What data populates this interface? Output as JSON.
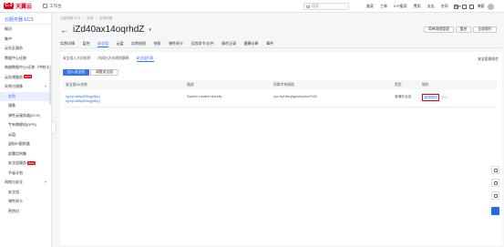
{
  "topbar": {
    "logo_mark": "C-3",
    "logo_text": "天翼云",
    "workspace": "工作台",
    "search_placeholder": "搜索",
    "links": [
      "备案",
      "工单",
      "ICP备案",
      "费用",
      "支出",
      "合同",
      "Ape"
    ],
    "user": "博客"
  },
  "sidebar": {
    "title": "云服务器 ECS",
    "items": [
      {
        "label": "概况",
        "type": "item"
      },
      {
        "label": "集中",
        "type": "item"
      },
      {
        "label": "云社区服务",
        "type": "item"
      },
      {
        "label": "数据中心迁移",
        "type": "item"
      },
      {
        "label": "跨越数据中心/迁移（中航卡）",
        "type": "item"
      },
      {
        "label": "云存储服务",
        "type": "item",
        "tag": "NEW"
      },
      {
        "label": "实例与镜像",
        "type": "group"
      },
      {
        "label": "实例",
        "type": "sub",
        "active": true
      },
      {
        "label": "镜像",
        "type": "sub"
      },
      {
        "label": "弹性云服务器(ECS)",
        "type": "sub"
      },
      {
        "label": "专有物理机(DPS)",
        "type": "sub"
      },
      {
        "label": "云盘",
        "type": "sub"
      },
      {
        "label": "虚拟IP跟踪器",
        "type": "sub"
      },
      {
        "label": "部署实例集",
        "type": "sub"
      },
      {
        "label": "安全组服务",
        "type": "sub",
        "tag": "NEW"
      },
      {
        "label": "节省计划",
        "type": "sub"
      },
      {
        "label": "网络与安全",
        "type": "group"
      },
      {
        "label": "安全组",
        "type": "sub"
      },
      {
        "label": "弹性网卡",
        "type": "sub"
      },
      {
        "label": "密钥对",
        "type": "sub"
      }
    ],
    "collapse_glyph": "‹"
  },
  "main": {
    "breadcrumb": [
      "云服务器 ECS",
      "/",
      "实例",
      "/",
      "实例详情"
    ],
    "back_glyph": "←",
    "title": "iZd40ax14oqrhdZ",
    "title_caret": "▾",
    "actions": [
      "简单网络管理",
      "重启",
      "全部操作"
    ],
    "tabs": [
      "实例详情",
      "监控",
      "安全组",
      "云盘",
      "实例快照",
      "快照",
      "弹性网卡",
      "远程命令/文件",
      "操作记录",
      "健康诊断",
      "事件"
    ],
    "active_tab": 2
  },
  "panel": {
    "subtabs": [
      "安全组入方向规则",
      "内网出方向规则解释",
      "安全组列表"
    ],
    "active_subtab": 2,
    "rule_link": "安全组规则栏",
    "primary_button": "加入安全组",
    "secondary_button": "调整安全组",
    "columns": [
      "安全组ID/名称",
      "描述",
      "所属专有网络",
      "类型",
      "操作"
    ],
    "rows": [
      {
        "id": "sg-bp1abfqd93eqjpf8yrj",
        "name": "sg-bp1abfqd93eqjpf8yrj",
        "description": "System created security...",
        "vpc": "vpc-bp1fbsqfqywdmydoz7h28",
        "type": "普通安全组",
        "op": "管理规则",
        "op_more": "移出"
      }
    ]
  },
  "float_tools": [
    "phone-icon",
    "chat-icon",
    "feedback-icon"
  ]
}
